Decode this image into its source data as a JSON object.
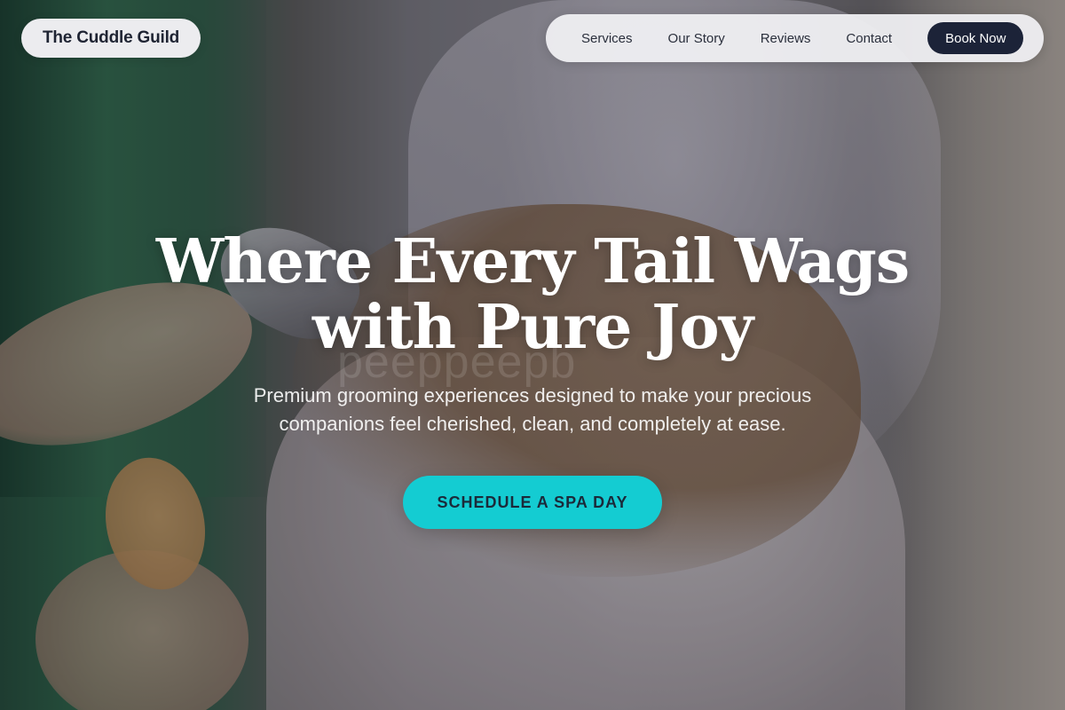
{
  "brand": {
    "name": "The Cuddle Guild"
  },
  "nav": {
    "links": [
      "Services",
      "Our Story",
      "Reviews",
      "Contact"
    ],
    "cta_label": "Book Now"
  },
  "hero": {
    "headline": "Where Every Tail Wags with Pure Joy",
    "subtitle": "Premium grooming experiences designed to make your precious companions feel cherished, clean, and completely at ease.",
    "cta_label": "SCHEDULE A SPA DAY",
    "background_image": "groomer-drying-dog-photo",
    "watermark": "peeppeepb"
  },
  "colors": {
    "accent": "#14ccd2",
    "dark": "#1c2338",
    "text_light": "#ffffff"
  }
}
